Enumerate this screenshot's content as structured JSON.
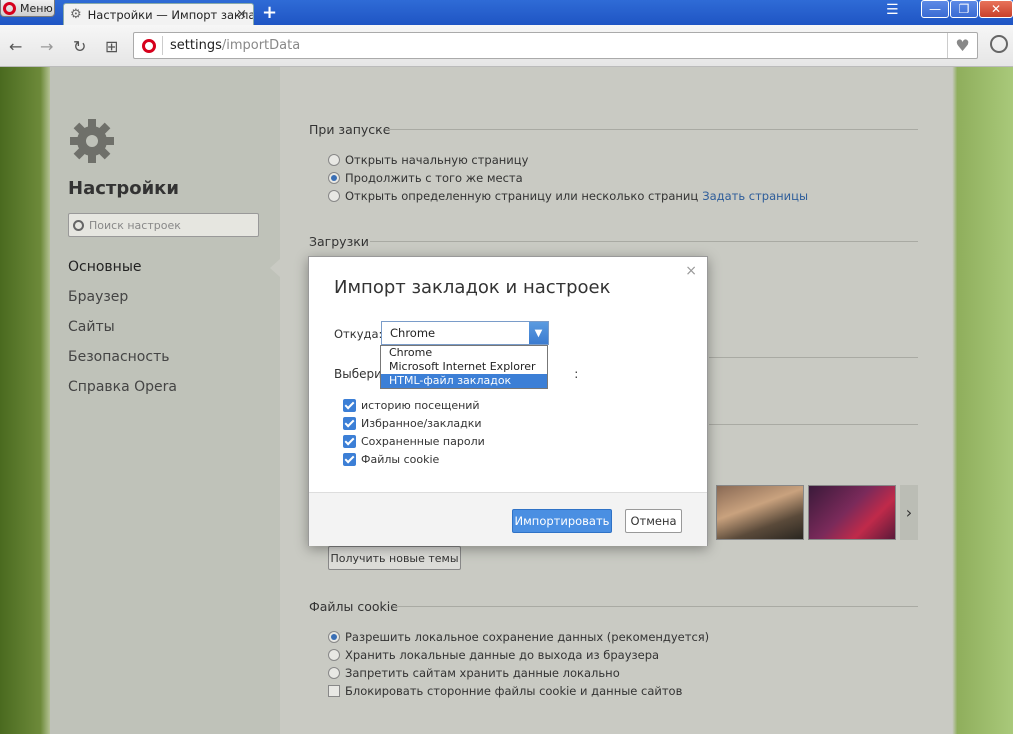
{
  "titlebar": {
    "menu_label": "Меню",
    "tab_title": "Настройки — Импорт заклад",
    "tab_close": "×",
    "new_tab": "+",
    "tabs_menu": "☰",
    "minimize": "—",
    "restore": "❐",
    "close": "✕"
  },
  "address": {
    "back": "←",
    "forward": "→",
    "reload": "↻",
    "speed_dial": "⊞",
    "url_host": "settings",
    "url_path": "/importData",
    "heart": "♥"
  },
  "sidebar": {
    "title": "Настройки",
    "search_placeholder": "Поиск настроек",
    "items": [
      {
        "label": "Основные",
        "active": true
      },
      {
        "label": "Браузер",
        "active": false
      },
      {
        "label": "Сайты",
        "active": false
      },
      {
        "label": "Безопасность",
        "active": false
      },
      {
        "label": "Справка Opera",
        "active": false
      }
    ]
  },
  "startup": {
    "heading": "При запуске",
    "options": [
      {
        "label": "Открыть начальную страницу",
        "selected": false
      },
      {
        "label": "Продолжить с того же места",
        "selected": true
      },
      {
        "label": "Открыть определенную страницу или несколько страниц",
        "selected": false,
        "link": "Задать страницы"
      }
    ]
  },
  "downloads": {
    "heading": "Загрузки"
  },
  "themes": {
    "get_button": "Получить новые темы",
    "arrow": "›"
  },
  "cookies": {
    "heading": "Файлы cookie",
    "options": [
      {
        "label": "Разрешить локальное сохранение данных (рекомендуется)",
        "selected": true
      },
      {
        "label": "Хранить локальные данные до выхода из браузера",
        "selected": false
      },
      {
        "label": "Запретить сайтам хранить данные локально",
        "selected": false
      }
    ],
    "block_third_party": "Блокировать сторонние файлы cookie и данные сайтов"
  },
  "dialog": {
    "title": "Импорт закладок и настроек",
    "close": "×",
    "from_label": "Откуда:",
    "from_value": "Chrome",
    "dropdown_options": [
      "Chrome",
      "Microsoft Internet Explorer",
      "HTML-файл закладок"
    ],
    "dropdown_highlighted": "HTML-файл закладок",
    "choose_label_start": "Выберите",
    "choose_label_end": ":",
    "checkboxes": [
      {
        "label": "историю посещений",
        "checked": true
      },
      {
        "label": "Избранное/закладки",
        "checked": true
      },
      {
        "label": "Сохраненные пароли",
        "checked": true
      },
      {
        "label": "Файлы cookie",
        "checked": true
      }
    ],
    "import_button": "Импортировать",
    "cancel_button": "Отмена"
  },
  "colors": {
    "accent": "#3c7fd6",
    "opera_red": "#d6001c",
    "titlebar": "#2f6bd6"
  }
}
